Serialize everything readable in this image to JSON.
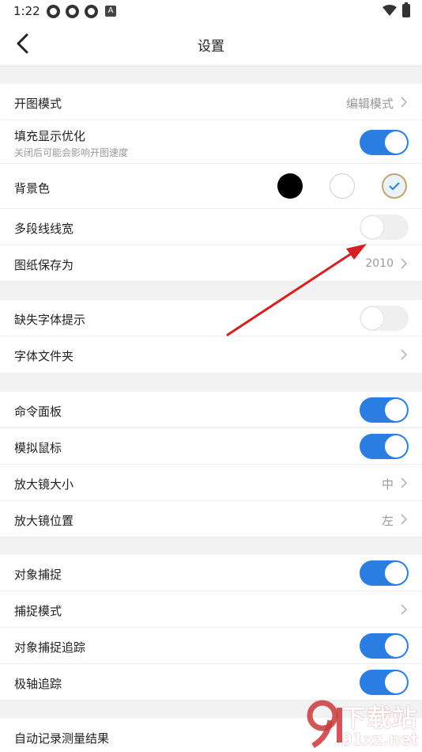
{
  "status_bar": {
    "time": "1:22",
    "notification_letter": "A"
  },
  "header": {
    "title": "设置"
  },
  "settings": {
    "open_mode": {
      "label": "开图模式",
      "value": "编辑模式"
    },
    "fill_display": {
      "label": "填充显示优化",
      "sub": "关闭后可能会影响开图速度",
      "enabled": true
    },
    "background": {
      "label": "背景色",
      "options": [
        "black",
        "white",
        "light-blue"
      ],
      "selected": "light-blue"
    },
    "polyline_width": {
      "label": "多段线线宽",
      "enabled": false
    },
    "save_as": {
      "label": "图纸保存为",
      "value": "2010"
    },
    "missing_font": {
      "label": "缺失字体提示",
      "enabled": false
    },
    "font_folder": {
      "label": "字体文件夹"
    },
    "command_panel": {
      "label": "命令面板",
      "enabled": true
    },
    "virtual_mouse": {
      "label": "模拟鼠标",
      "enabled": true
    },
    "magnifier_size": {
      "label": "放大镜大小",
      "value": "中"
    },
    "magnifier_pos": {
      "label": "放大镜位置",
      "value": "左"
    },
    "osnap": {
      "label": "对象捕捉",
      "enabled": true
    },
    "snap_mode": {
      "label": "捕捉模式"
    },
    "osnap_tracking": {
      "label": "对象捕捉追踪",
      "enabled": true
    },
    "polar_tracking": {
      "label": "极轴追踪",
      "enabled": true
    },
    "auto_record": {
      "label": "自动记录测量结果"
    }
  },
  "watermark": {
    "line1": "下载站",
    "line2": "91xz.net"
  },
  "colors": {
    "accent": "#2a7de1",
    "arrow": "#d42020",
    "divider": "#f2f2f2"
  }
}
